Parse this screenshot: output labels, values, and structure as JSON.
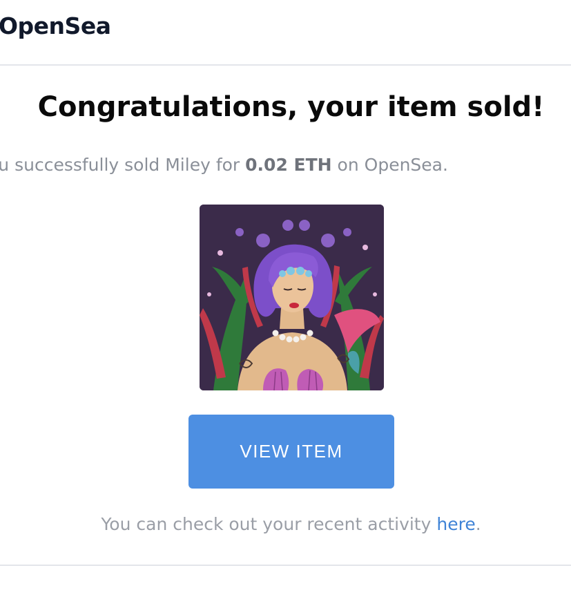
{
  "header": {
    "brand": "OpenSea"
  },
  "message": {
    "headline": "Congratulations, your item sold!",
    "summary_prefix": "ou successfully sold Miley for ",
    "summary_amount": "0.02 ETH",
    "summary_suffix": " on OpenSea."
  },
  "item": {
    "image_icon": "mermaid-artwork-icon"
  },
  "actions": {
    "view_item_label": "VIEW ITEM"
  },
  "footer": {
    "text_prefix": "You can check out your recent activity ",
    "link_text": "here",
    "text_suffix": "."
  },
  "colors": {
    "button": "#4d8fe2",
    "link": "#3f83d6",
    "heading": "#0a0a0a",
    "muted_text": "#8a8f98"
  }
}
